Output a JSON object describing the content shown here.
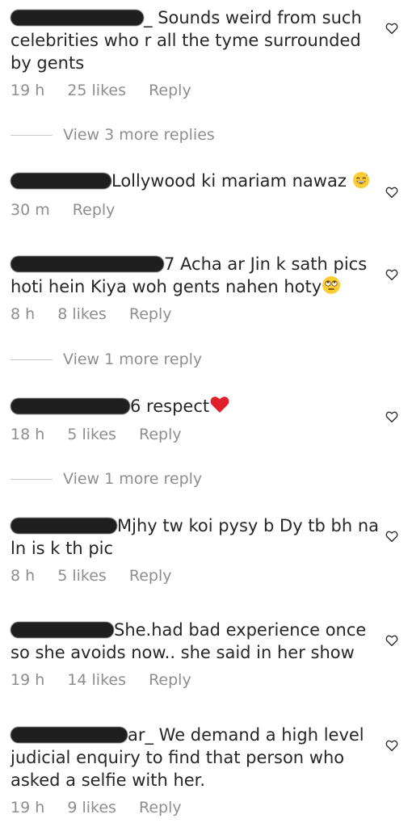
{
  "comments": [
    {
      "text": "Sounds weird from such celebrities who r all the tyme surrounded by gents",
      "time": "19 h",
      "likes": "25 likes",
      "reply": "Reply",
      "view_more": "View 3 more replies"
    },
    {
      "text": "Lollywood ki mariam nawaz",
      "emoji": "grinning-sweat-emoji",
      "time": "30 m",
      "reply": "Reply"
    },
    {
      "text": "7 Acha ar Jin k sath pics hoti hein Kiya woh gents nahen hoty",
      "emoji": "rolling-eyes-emoji",
      "time": "8 h",
      "likes": "8 likes",
      "reply": "Reply",
      "view_more": "View 1 more reply"
    },
    {
      "text": "6 respect",
      "emoji": "red-heart-emoji",
      "time": "18 h",
      "likes": "5 likes",
      "reply": "Reply",
      "view_more": "View 1 more reply"
    },
    {
      "text": "Mjhy tw koi pysy b Dy tb bh na ln is k th pic",
      "time": "8 h",
      "likes": "5 likes",
      "reply": "Reply"
    },
    {
      "text": "She.had bad experience once so she avoids now.. she said in her show",
      "time": "19 h",
      "likes": "14 likes",
      "reply": "Reply"
    },
    {
      "text": "ar_ We demand a high level judicial enquiry to find that person who asked a selfie with her.",
      "time": "19 h",
      "likes": "9 likes",
      "reply": "Reply"
    }
  ],
  "colors": {
    "text": "#262626",
    "secondary": "#8e8e8e",
    "divider": "#c7c7c7",
    "redaction": "#1f1f1f"
  }
}
